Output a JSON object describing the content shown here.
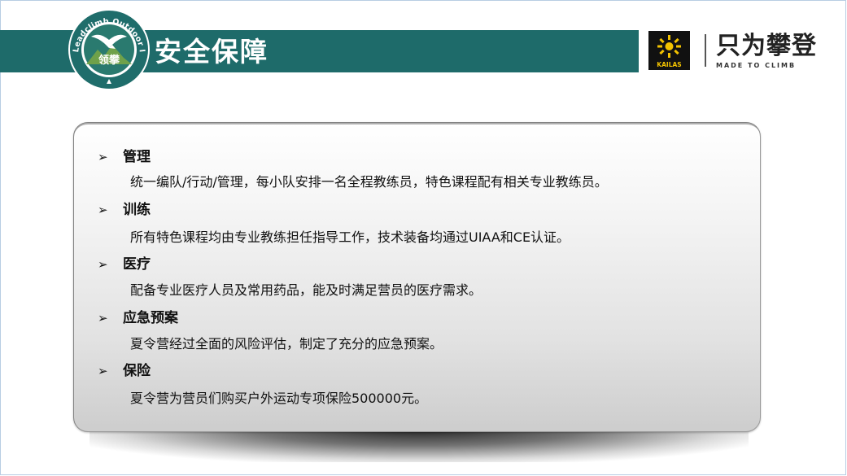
{
  "header": {
    "title": "安全保障",
    "badge": {
      "ring_text": "Leadclimb Outdoor Instruction Center",
      "center_text": "领攀"
    },
    "brand": {
      "logo_text": "KAILAS",
      "slogan": "只为攀登",
      "slogan_sub": "MADE TO CLIMB"
    }
  },
  "items": [
    {
      "heading": "管理",
      "detail": "统一编队/行动/管理，每小队安排一名全程教练员，特色课程配有相关专业教练员。"
    },
    {
      "heading": "训练",
      "detail": "所有特色课程均由专业教练担任指导工作，技术装备均通过UIAA和CE认证。"
    },
    {
      "heading": "医疗",
      "detail": "配备专业医疗人员及常用药品，能及时满足营员的医疗需求。"
    },
    {
      "heading": "应急预案",
      "detail": "夏令营经过全面的风险评估，制定了充分的应急预案。"
    },
    {
      "heading": "保险",
      "detail": "夏令营为营员们购买户外运动专项保险500000元。"
    }
  ],
  "icons": {
    "bullet": "arrow-right-icon"
  },
  "colors": {
    "title_bar": "#1e6b6a",
    "badge_ring": "#1f6d6b",
    "kailas_yellow": "#f2c200",
    "text": "#111111"
  }
}
